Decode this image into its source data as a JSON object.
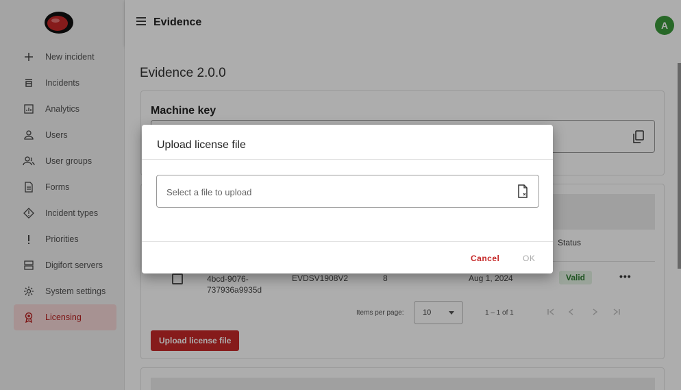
{
  "header": {
    "title": "Evidence",
    "avatar_initial": "A",
    "avatar_color": "#3b9a3b"
  },
  "sidebar": {
    "items": [
      {
        "label": "New incident",
        "icon": "plus-icon"
      },
      {
        "label": "Incidents",
        "icon": "incidents-icon"
      },
      {
        "label": "Analytics",
        "icon": "analytics-icon"
      },
      {
        "label": "Users",
        "icon": "user-icon"
      },
      {
        "label": "User groups",
        "icon": "user-groups-icon"
      },
      {
        "label": "Forms",
        "icon": "form-icon"
      },
      {
        "label": "Incident types",
        "icon": "incident-type-icon"
      },
      {
        "label": "Priorities",
        "icon": "exclamation-icon"
      },
      {
        "label": "Digifort servers",
        "icon": "server-icon"
      },
      {
        "label": "System settings",
        "icon": "gear-icon"
      },
      {
        "label": "Licensing",
        "icon": "license-icon",
        "active": true
      }
    ]
  },
  "main": {
    "title": "Evidence 2.0.0",
    "machine_key": {
      "title": "Machine key"
    },
    "licenses": {
      "status_header": "Status",
      "row": {
        "id": "4bcd-9076-737936a9935d",
        "machine": "EVDSV1908V2",
        "count": "8",
        "date": "Aug 1, 2024",
        "status": "Valid",
        "menu": "•••"
      },
      "pager": {
        "items_per_page_label": "Items per page:",
        "items_per_page": "10",
        "range": "1 – 1 of 1"
      },
      "upload_button": "Upload license file"
    }
  },
  "dialog": {
    "title": "Upload license file",
    "placeholder": "Select a file to upload",
    "cancel": "Cancel",
    "ok": "OK"
  },
  "colors": {
    "accent": "#c62828",
    "valid": "#2e7d32"
  }
}
